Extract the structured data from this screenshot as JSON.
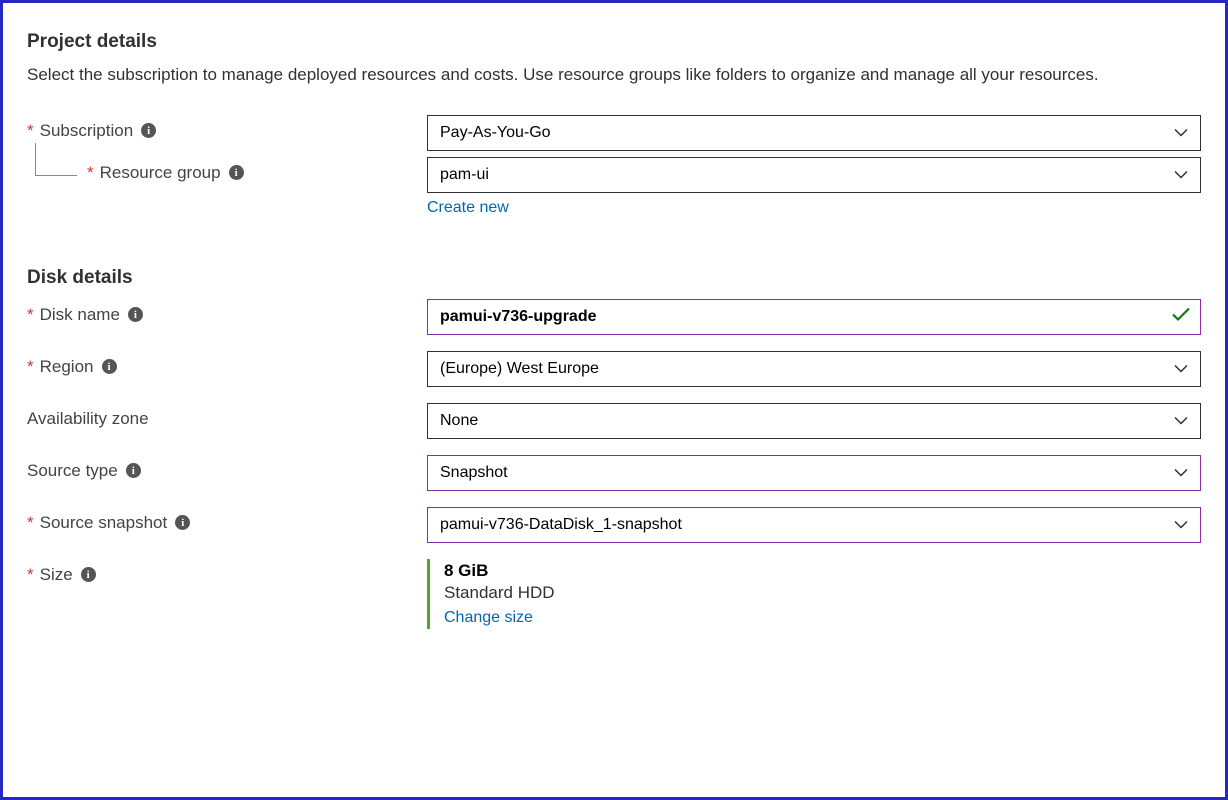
{
  "project": {
    "title": "Project details",
    "description": "Select the subscription to manage deployed resources and costs. Use resource groups like folders to organize and manage all your resources.",
    "subscription": {
      "label": "Subscription",
      "value": "Pay-As-You-Go"
    },
    "resourceGroup": {
      "label": "Resource group",
      "value": "pam-ui",
      "createNew": "Create new"
    }
  },
  "disk": {
    "title": "Disk details",
    "name": {
      "label": "Disk name",
      "value": "pamui-v736-upgrade"
    },
    "region": {
      "label": "Region",
      "value": "(Europe) West Europe"
    },
    "availabilityZone": {
      "label": "Availability zone",
      "value": "None"
    },
    "sourceType": {
      "label": "Source type",
      "value": "Snapshot"
    },
    "sourceSnapshot": {
      "label": "Source snapshot",
      "value": "pamui-v736-DataDisk_1-snapshot"
    },
    "size": {
      "label": "Size",
      "value": "8 GiB",
      "tier": "Standard HDD",
      "changeLink": "Change size"
    }
  }
}
